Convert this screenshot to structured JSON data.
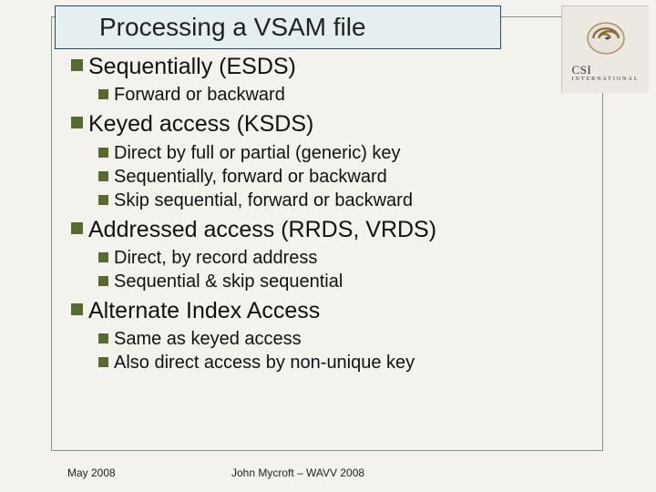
{
  "title": "Processing a VSAM file",
  "logo": {
    "main": "CSI",
    "sub": "INTERNATIONAL"
  },
  "sections": [
    {
      "heading": "Sequentially (ESDS)",
      "items": [
        "Forward or backward"
      ]
    },
    {
      "heading": "Keyed access (KSDS)",
      "items": [
        "Direct by full or partial (generic) key",
        "Sequentially, forward or backward",
        "Skip sequential, forward or backward"
      ]
    },
    {
      "heading": "Addressed access (RRDS, VRDS)",
      "items": [
        "Direct, by record address",
        "Sequential & skip sequential"
      ]
    },
    {
      "heading": "Alternate Index Access",
      "items": [
        "Same as keyed access",
        "Also direct access by non-unique key"
      ]
    }
  ],
  "footer": {
    "date": "May 2008",
    "author": "John Mycroft – WAVV 2008"
  }
}
